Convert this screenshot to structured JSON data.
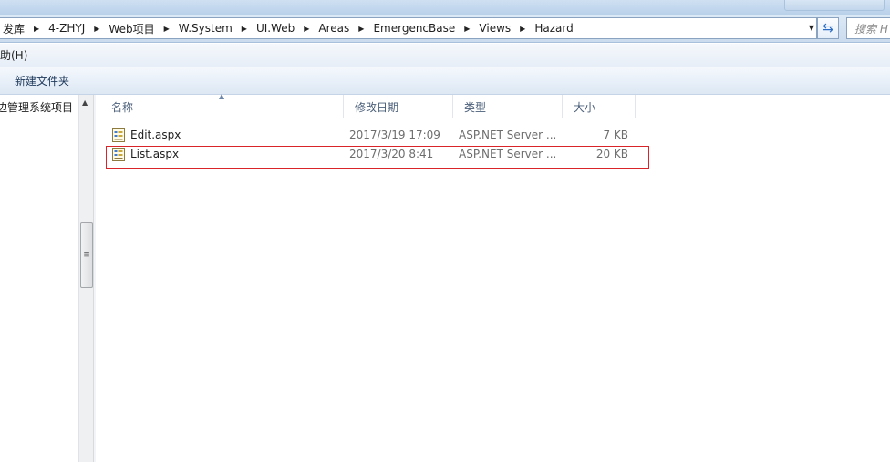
{
  "address": {
    "crumbs": [
      "发库",
      "4-ZHYJ",
      "Web项目",
      "W.System",
      "UI.Web",
      "Areas",
      "EmergencBase",
      "Views",
      "Hazard"
    ],
    "search_placeholder": "搜索 H"
  },
  "menu": {
    "help_label": "助(H)"
  },
  "toolbar": {
    "new_folder_label": "新建文件夹"
  },
  "nav": {
    "item_label": "边管理系统项目"
  },
  "columns": {
    "name": "名称",
    "date": "修改日期",
    "type": "类型",
    "size": "大小"
  },
  "files": [
    {
      "name": "Edit.aspx",
      "modified": "2017/3/19 17:09",
      "type": "ASP.NET Server ...",
      "size": "7 KB",
      "icon": "aspx-file-icon"
    },
    {
      "name": "List.aspx",
      "modified": "2017/3/20 8:41",
      "type": "ASP.NET Server ...",
      "size": "20 KB",
      "icon": "aspx-file-icon"
    }
  ],
  "colors": {
    "highlight": "#d9242a",
    "header_text": "#4c607a",
    "address_border": "#8aa3c0"
  }
}
